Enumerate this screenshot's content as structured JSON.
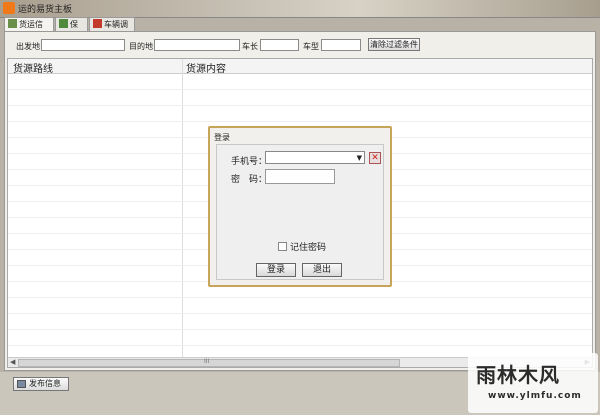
{
  "window": {
    "title": "运的易货主板",
    "icon": "app-icon"
  },
  "tabs": [
    {
      "label": "货运信息",
      "icon": "truck-icon",
      "active": true
    },
    {
      "label": "保险",
      "icon": "shield-icon",
      "active": false
    },
    {
      "label": "车辆调度",
      "icon": "scheduler-icon",
      "active": false
    }
  ],
  "filters": {
    "origin_label": "出发地",
    "destination_label": "目的地",
    "length_label": "车长",
    "type_label": "车型",
    "clear_button": "清除过滤条件"
  },
  "grid": {
    "columns": [
      "货源路线",
      "货源内容"
    ],
    "scroll_grip": "III"
  },
  "bottom": {
    "publish_button": "发布信息"
  },
  "login_dialog": {
    "title": "登录",
    "phone_label": "手机号：",
    "password_label": "密　码：",
    "remember_label": "记住密码",
    "remember_checked": false,
    "login_button": "登录",
    "exit_button": "退出",
    "clear_icon": "close-icon"
  },
  "watermark": {
    "main": "雨林木风",
    "sub": "www.ylmfu.com"
  },
  "colors": {
    "dialog_border": "#c7a45a",
    "app_icon": "#f07a1a",
    "clear_x": "#cc2222"
  }
}
